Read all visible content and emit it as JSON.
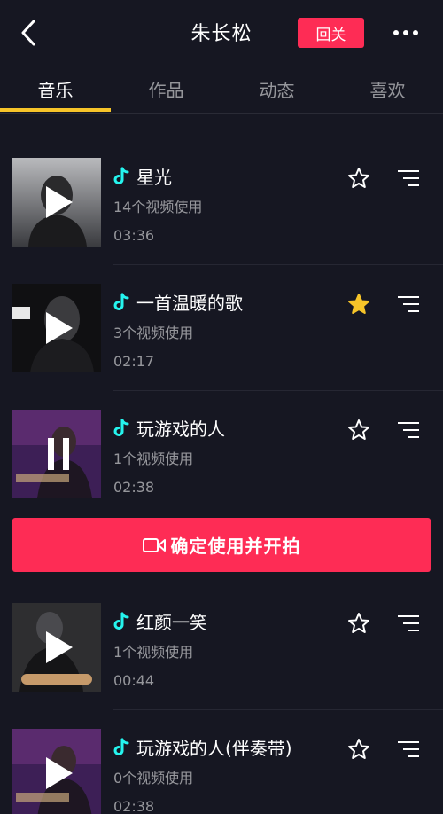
{
  "header": {
    "title": "朱长松",
    "follow_label": "回关"
  },
  "tabs": [
    {
      "label": "音乐",
      "active": true
    },
    {
      "label": "作品",
      "active": false
    },
    {
      "label": "动态",
      "active": false
    },
    {
      "label": "喜欢",
      "active": false
    }
  ],
  "songs": [
    {
      "title": "星光",
      "usage": "14个视频使用",
      "duration": "03:36",
      "favorited": false,
      "state": "paused"
    },
    {
      "title": "一首温暖的歌",
      "usage": "3个视频使用",
      "duration": "02:17",
      "favorited": true,
      "state": "paused"
    },
    {
      "title": "玩游戏的人",
      "usage": "1个视频使用",
      "duration": "02:38",
      "favorited": false,
      "state": "playing"
    },
    {
      "title": "红颜一笑",
      "usage": "1个视频使用",
      "duration": "00:44",
      "favorited": false,
      "state": "paused"
    },
    {
      "title": "玩游戏的人(伴奏带)",
      "usage": "0个视频使用",
      "duration": "02:38",
      "favorited": false,
      "state": "paused"
    }
  ],
  "confirm": {
    "label": "确定使用并开拍"
  },
  "colors": {
    "background": "#161722",
    "accent": "#fe2c55",
    "tab_indicator": "#f6c429",
    "star_active": "#f6c429",
    "note_cyan": "#25f4ee"
  },
  "icons": {
    "back": "chevron-left-icon",
    "more": "more-dots-icon",
    "note": "music-note-icon",
    "play": "play-icon",
    "pause": "pause-icon",
    "star": "star-icon",
    "menu": "list-menu-icon",
    "camera": "camera-icon"
  }
}
